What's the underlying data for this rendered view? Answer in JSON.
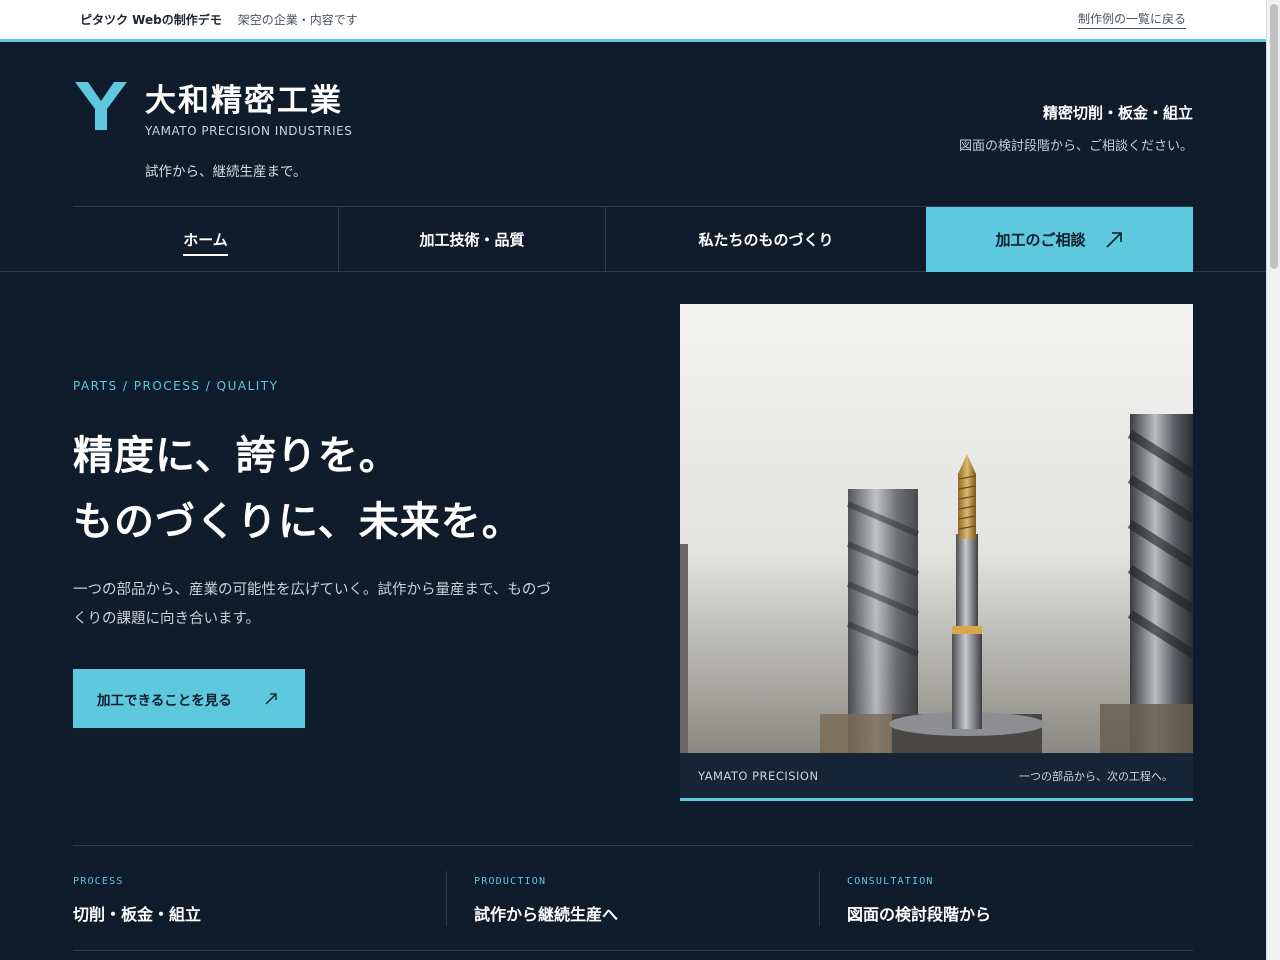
{
  "topbar": {
    "demo_title": "ピタツク Webの制作デモ",
    "demo_note": "架空の企業・内容です",
    "back_link": "制作例の一覧に戻る"
  },
  "header": {
    "logo_letter": "Y",
    "company_name": "大和精密工業",
    "company_en": "YAMATO PRECISION INDUSTRIES",
    "tagline": "試作から、継続生産まで。",
    "right_title": "精密切削・板金・組立",
    "right_sub": "図面の検討段階から、ご相談ください。"
  },
  "nav": {
    "items": [
      {
        "label": "ホーム",
        "active": true
      },
      {
        "label": "加工技術・品質"
      },
      {
        "label": "私たちのものづくり"
      },
      {
        "label": "加工のご相談"
      }
    ]
  },
  "hero": {
    "eyebrow": "PARTS / PROCESS / QUALITY",
    "title_line1": "精度に、誇りを。",
    "title_line2": "ものづくりに、未来を。",
    "text": "一つの部品から、産業の可能性を広げていく。試作から量産まで、ものづくりの課題に向き合います。",
    "button_label": "加工できることを見る"
  },
  "photo": {
    "caption_left": "YAMATO PRECISION",
    "caption_right": "一つの部品から、次の工程へ。"
  },
  "features": [
    {
      "label": "PROCESS",
      "title": "切削・板金・組立"
    },
    {
      "label": "PRODUCTION",
      "title": "試作から継続生産へ"
    },
    {
      "label": "CONSULTATION",
      "title": "図面の検討段階から"
    }
  ],
  "colors": {
    "background": "#0e1c2b",
    "accent": "#5ec8de",
    "text": "#ffffff"
  },
  "icons": {
    "logo": "y-logo-icon",
    "arrow": "arrow-up-right-icon"
  }
}
